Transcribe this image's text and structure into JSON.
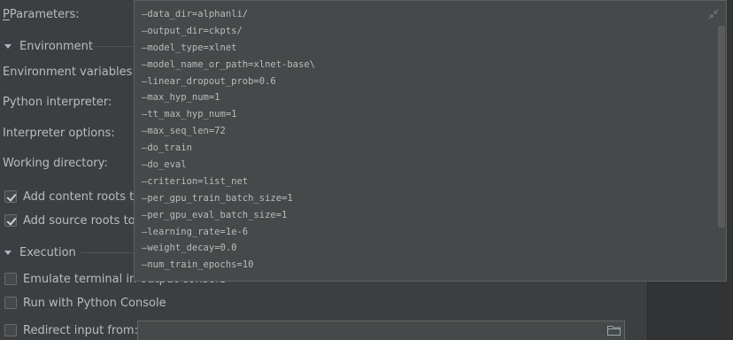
{
  "form": {
    "parameters_label": "Parameters:",
    "environment_section": "Environment",
    "env_vars_label": "Environment variables:",
    "python_interpreter_label": "Python interpreter:",
    "interpreter_options_label": "Interpreter options:",
    "working_directory_label": "Working directory:",
    "add_content_roots_label": "Add content roots to",
    "add_content_roots_checked": true,
    "add_source_roots_label": "Add source roots to F",
    "add_source_roots_checked": true,
    "execution_section": "Execution",
    "emulate_terminal_label": "Emulate terminal in output console",
    "emulate_terminal_checked": false,
    "run_python_console_label": "Run with Python Console",
    "run_python_console_checked": false,
    "redirect_input_label": "Redirect input from:",
    "redirect_input_checked": false,
    "redirect_input_value": ""
  },
  "popup": {
    "lines": [
      "—data_dir=alphanli/",
      "—output_dir=ckpts/",
      "—model_type=xlnet",
      "—model_name_or_path=xlnet-base\\",
      "—linear_dropout_prob=0.6",
      "—max_hyp_num=1",
      "—tt_max_hyp_num=1",
      "—max_seq_len=72",
      "—do_train",
      "—do_eval",
      "—criterion=list_net",
      "—per_gpu_train_batch_size=1",
      "—per_gpu_eval_batch_size=1",
      "—learning_rate=1e-6",
      "—weight_decay=0.0",
      "—num_train_epochs=10"
    ]
  },
  "icons": {
    "collapse": "collapse-arrows-icon",
    "folder": "folder-icon",
    "section_toggle": "triangle-down-icon",
    "checkmark": "checkmark-icon"
  },
  "colors": {
    "background": "#3c3f41",
    "popup_background": "#45494a",
    "text": "#bbbbbb",
    "border": "#5e6060"
  }
}
